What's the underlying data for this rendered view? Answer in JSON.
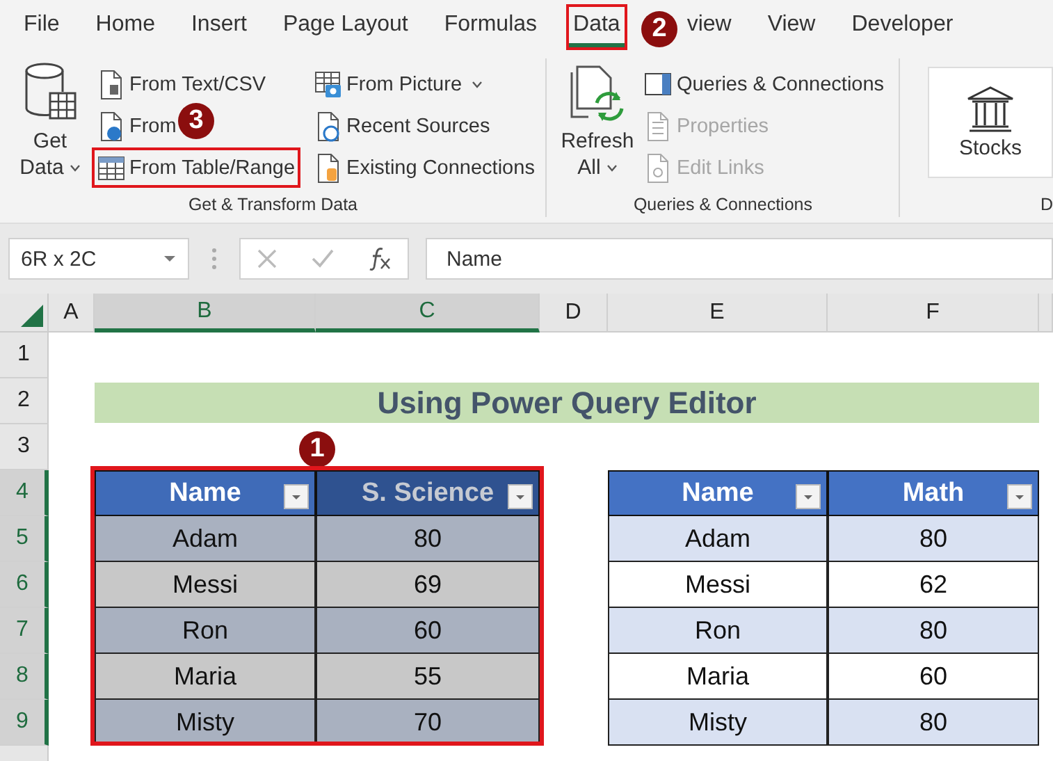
{
  "ribbon": {
    "tabs": [
      {
        "label": "File",
        "selected": false,
        "highlighted": false
      },
      {
        "label": "Home",
        "selected": false,
        "highlighted": false
      },
      {
        "label": "Insert",
        "selected": false,
        "highlighted": false
      },
      {
        "label": "Page Layout",
        "selected": false,
        "highlighted": false
      },
      {
        "label": "Formulas",
        "selected": false,
        "highlighted": false
      },
      {
        "label": "Data",
        "selected": true,
        "highlighted": true
      },
      {
        "label": "view",
        "selected": false,
        "highlighted": false
      },
      {
        "label": "View",
        "selected": false,
        "highlighted": false
      },
      {
        "label": "Developer",
        "selected": false,
        "highlighted": false
      }
    ],
    "groups": [
      {
        "label": "Get & Transform Data",
        "big": {
          "kind": "database",
          "lines": [
            "Get",
            "Data"
          ],
          "caret": true
        },
        "columns": [
          [
            {
              "label": "From Text/CSV",
              "disabled": false,
              "highlighted": false,
              "caret": false
            },
            {
              "label": "From",
              "disabled": false,
              "highlighted": false,
              "caret": false
            },
            {
              "label": "From Table/Range",
              "disabled": false,
              "highlighted": true,
              "caret": false
            }
          ],
          [
            {
              "label": "From Picture",
              "disabled": false,
              "highlighted": false,
              "caret": true
            },
            {
              "label": "Recent Sources",
              "disabled": false,
              "highlighted": false,
              "caret": false
            },
            {
              "label": "Existing Connections",
              "disabled": false,
              "highlighted": false,
              "caret": false
            }
          ]
        ]
      },
      {
        "label": "Queries & Connections",
        "big": {
          "kind": "refresh",
          "lines": [
            "Refresh",
            "All"
          ],
          "caret": true
        },
        "columns": [
          [
            {
              "label": "Queries & Connections",
              "disabled": false,
              "highlighted": false,
              "caret": false
            },
            {
              "label": "Properties",
              "disabled": true,
              "highlighted": false,
              "caret": false
            },
            {
              "label": "Edit Links",
              "disabled": true,
              "highlighted": false,
              "caret": false
            }
          ]
        ]
      },
      {
        "label": "D",
        "big": {
          "kind": "bank",
          "lines": [
            "Stocks"
          ],
          "caret": false
        }
      }
    ]
  },
  "formula_bar": {
    "name_box": "6R x 2C",
    "formula": "Name"
  },
  "sheet": {
    "columns": [
      {
        "label": "A",
        "selected": false
      },
      {
        "label": "B",
        "selected": true
      },
      {
        "label": "C",
        "selected": true
      },
      {
        "label": "D",
        "selected": false
      },
      {
        "label": "E",
        "selected": false
      },
      {
        "label": "F",
        "selected": false
      }
    ],
    "rows": [
      {
        "label": "1",
        "selected": false
      },
      {
        "label": "2",
        "selected": false
      },
      {
        "label": "3",
        "selected": false
      },
      {
        "label": "4",
        "selected": true
      },
      {
        "label": "5",
        "selected": true
      },
      {
        "label": "6",
        "selected": true
      },
      {
        "label": "7",
        "selected": true
      },
      {
        "label": "8",
        "selected": true
      },
      {
        "label": "9",
        "selected": true
      }
    ],
    "title": "Using Power Query Editor",
    "tables": [
      {
        "selected": true,
        "highlighted": true,
        "columns": [
          "Name",
          "S. Science"
        ],
        "rows": [
          [
            "Adam",
            "80"
          ],
          [
            "Messi",
            "69"
          ],
          [
            "Ron",
            "60"
          ],
          [
            "Maria",
            "55"
          ],
          [
            "Misty",
            "70"
          ]
        ]
      },
      {
        "selected": false,
        "highlighted": false,
        "columns": [
          "Name",
          "Math"
        ],
        "rows": [
          [
            "Adam",
            "80"
          ],
          [
            "Messi",
            "62"
          ],
          [
            "Ron",
            "80"
          ],
          [
            "Maria",
            "60"
          ],
          [
            "Misty",
            "80"
          ]
        ]
      }
    ]
  },
  "markers": [
    "1",
    "2",
    "3"
  ]
}
